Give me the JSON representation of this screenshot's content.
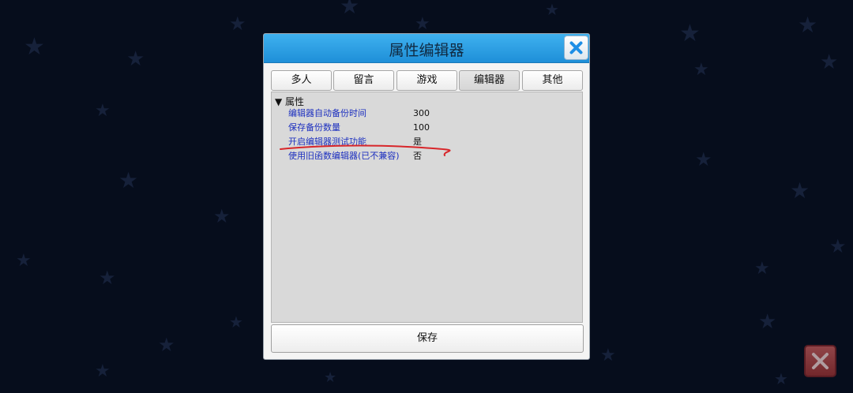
{
  "dialog": {
    "title": "属性编辑器"
  },
  "tabs": [
    {
      "label": "多人",
      "active": false
    },
    {
      "label": "留言",
      "active": false
    },
    {
      "label": "游戏",
      "active": false
    },
    {
      "label": "编辑器",
      "active": true
    },
    {
      "label": "其他",
      "active": false
    }
  ],
  "properties": {
    "category": "▼ 属性",
    "rows": [
      {
        "name": "编辑器自动备份时间",
        "value": "300"
      },
      {
        "name": "保存备份数量",
        "value": "100"
      },
      {
        "name": "开启编辑器测试功能",
        "value": "是"
      },
      {
        "name": "使用旧函数编辑器(已不兼容)",
        "value": "否"
      }
    ]
  },
  "save_label": "保存",
  "colors": {
    "title_bar": "#2fa0e6",
    "property_name": "#1c2fbf",
    "annotation": "#d8262a",
    "corner_close": "#b44848"
  },
  "icons": {
    "dialog_close": "close-x-icon",
    "corner_close": "close-x-icon",
    "background": "star-icon"
  }
}
